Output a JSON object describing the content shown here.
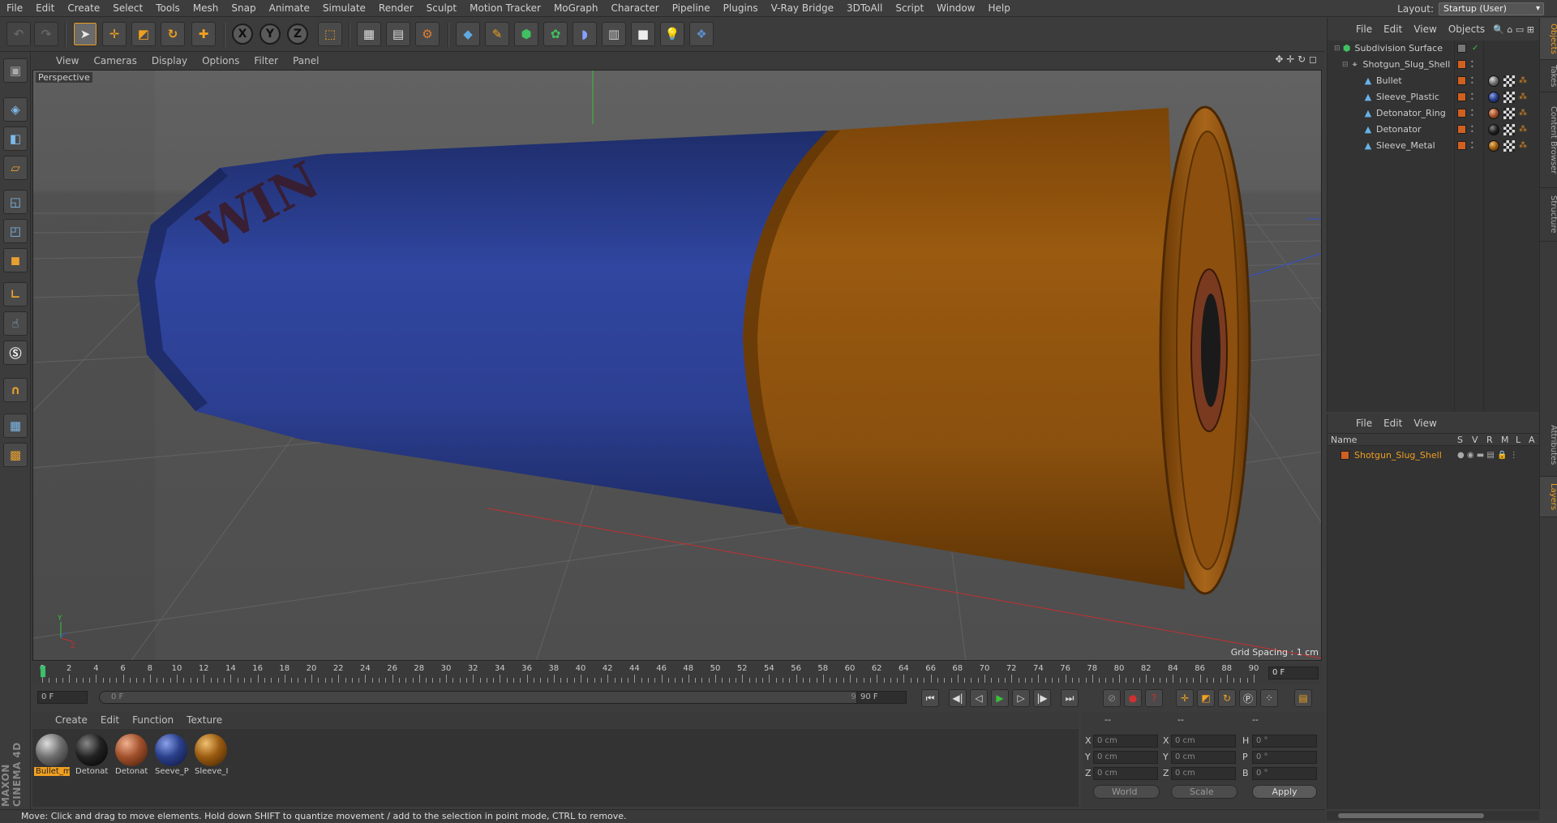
{
  "menubar": {
    "items": [
      "File",
      "Edit",
      "Create",
      "Select",
      "Tools",
      "Mesh",
      "Snap",
      "Animate",
      "Simulate",
      "Render",
      "Sculpt",
      "Motion Tracker",
      "MoGraph",
      "Character",
      "Pipeline",
      "Plugins",
      "V-Ray Bridge",
      "3DToAll",
      "Script",
      "Window",
      "Help"
    ],
    "layout_label": "Layout:",
    "layout_value": "Startup (User)"
  },
  "viewport": {
    "menu": [
      "View",
      "Cameras",
      "Display",
      "Options",
      "Filter",
      "Panel"
    ],
    "camera_label": "Perspective",
    "grid_spacing": "Grid Spacing : 1 cm",
    "shell_text": "WIN"
  },
  "timeline": {
    "ticks": [
      "0",
      "2",
      "4",
      "6",
      "8",
      "10",
      "12",
      "14",
      "16",
      "18",
      "20",
      "22",
      "24",
      "26",
      "28",
      "30",
      "32",
      "34",
      "36",
      "38",
      "40",
      "42",
      "44",
      "46",
      "48",
      "50",
      "52",
      "54",
      "56",
      "58",
      "60",
      "62",
      "64",
      "66",
      "68",
      "70",
      "72",
      "74",
      "76",
      "78",
      "80",
      "82",
      "84",
      "86",
      "88",
      "90"
    ],
    "current_frame_right": "0 F",
    "start_field": "0 F",
    "range_start": "0 F",
    "range_end": "90 F",
    "end_field": "90 F"
  },
  "materials": {
    "menu": [
      "Create",
      "Edit",
      "Function",
      "Texture"
    ],
    "items": [
      {
        "label": "Bullet_m",
        "color": "#6e6e6e"
      },
      {
        "label": "Detonat",
        "color": "#222222"
      },
      {
        "label": "Detonat",
        "color": "#a0502a"
      },
      {
        "label": "Seeve_P",
        "color": "#2a3f8a"
      },
      {
        "label": "Sleeve_I",
        "color": "#9a5a10"
      }
    ]
  },
  "coordinates": {
    "header": [
      "--",
      "--",
      "--"
    ],
    "rows": [
      {
        "pos_label": "X",
        "pos": "0 cm",
        "size_label": "X",
        "size": "0 cm",
        "rot_label": "H",
        "rot": "0 °"
      },
      {
        "pos_label": "Y",
        "pos": "0 cm",
        "size_label": "Y",
        "size": "0 cm",
        "rot_label": "P",
        "rot": "0 °"
      },
      {
        "pos_label": "Z",
        "pos": "0 cm",
        "size_label": "Z",
        "size": "0 cm",
        "rot_label": "B",
        "rot": "0 °"
      }
    ],
    "world_dropdown": "World",
    "scale_dropdown": "Scale",
    "apply_label": "Apply"
  },
  "status_text": "Move: Click and drag to move elements. Hold down SHIFT to quantize movement / add to the selection in point mode, CTRL to remove.",
  "object_manager": {
    "menu": [
      "File",
      "Edit",
      "View",
      "Objects"
    ],
    "objects": [
      {
        "name": "Subdivision Surface",
        "indent": 0,
        "icon": "subdivision-icon"
      },
      {
        "name": "Shotgun_Slug_Shell",
        "indent": 1,
        "icon": "null-icon"
      },
      {
        "name": "Bullet",
        "indent": 2,
        "icon": "polygon-icon",
        "mat": "#6e6e6e"
      },
      {
        "name": "Sleeve_Plastic",
        "indent": 2,
        "icon": "polygon-icon",
        "mat": "#2a3f8a"
      },
      {
        "name": "Detonator_Ring",
        "indent": 2,
        "icon": "polygon-icon",
        "mat": "#a0502a"
      },
      {
        "name": "Detonator",
        "indent": 2,
        "icon": "polygon-icon",
        "mat": "#222222"
      },
      {
        "name": "Sleeve_Metal",
        "indent": 2,
        "icon": "polygon-icon",
        "mat": "#9a5a10"
      }
    ]
  },
  "layer_manager": {
    "menu": [
      "File",
      "Edit",
      "View"
    ],
    "columns": [
      "Name",
      "S",
      "V",
      "R",
      "M",
      "L",
      "A"
    ],
    "layers": [
      {
        "name": "Shotgun_Slug_Shell",
        "color": "#d06020"
      }
    ]
  },
  "side_tabs": [
    "Objects",
    "Takes",
    "Content Browser",
    "Structure",
    "Attributes",
    "Layers"
  ],
  "branding": "MAXON CINEMA 4D",
  "colors": {
    "accent": "#f0a020",
    "sleeve_plastic": "#2a3f8a",
    "sleeve_metal": "#9a5a10"
  }
}
